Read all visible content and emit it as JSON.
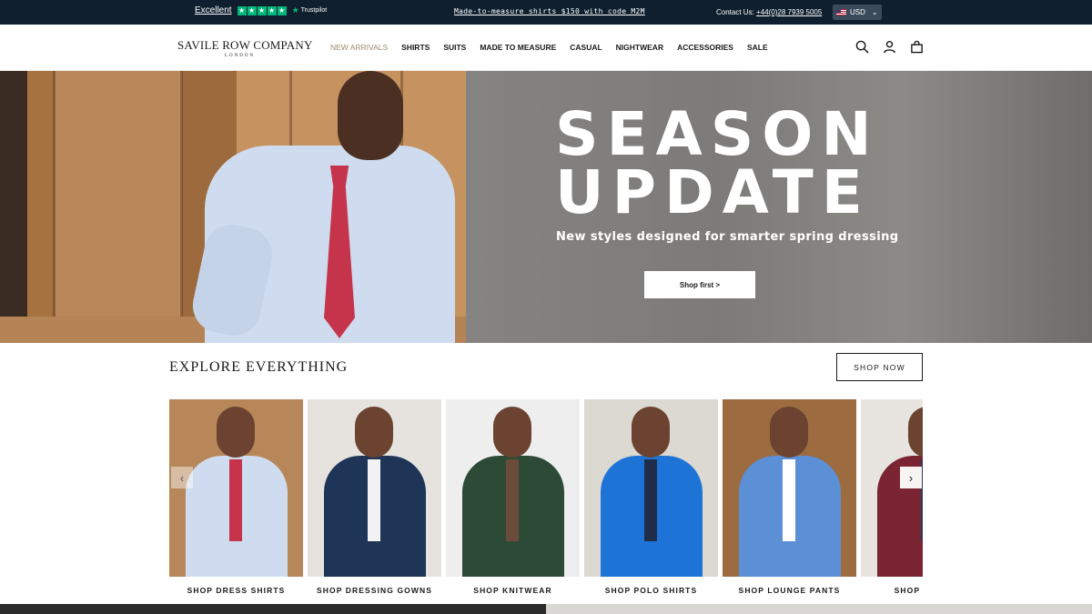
{
  "topbar": {
    "trustpilot_rating": "Excellent",
    "trustpilot_brand": "Trustpilot",
    "stars": [
      "★",
      "★",
      "★",
      "★",
      "★"
    ],
    "promo": "Made-to-measure shirts $150 with code M2M",
    "contact_label": "Contact Us:",
    "contact_phone": "+44(0)28 7939 5005",
    "currency": "USD"
  },
  "header": {
    "logo_main": "SAVILE ROW COMPANY",
    "logo_sub": "LONDON",
    "nav": [
      "NEW ARRIVALS",
      "SHIRTS",
      "SUITS",
      "MADE TO MEASURE",
      "CASUAL",
      "NIGHTWEAR",
      "ACCESSORIES",
      "SALE"
    ],
    "icons": [
      "search-icon",
      "account-icon",
      "bag-icon"
    ]
  },
  "hero": {
    "title_line1": "SEASON",
    "title_line2": "UPDATE",
    "subtitle": "New styles designed for smarter spring dressing",
    "cta": "Shop first >"
  },
  "explore": {
    "title": "EXPLORE EVERYTHING",
    "shop_now": "SHOP NOW",
    "cards": [
      {
        "label": "SHOP DRESS SHIRTS",
        "bg": "#b7875a",
        "fig": "#cfdcef",
        "accent": "#c5344a"
      },
      {
        "label": "SHOP DRESSING GOWNS",
        "bg": "#e6e3df",
        "fig": "#1f3557",
        "accent": "#f2f2f2"
      },
      {
        "label": "SHOP KNITWEAR",
        "bg": "#eeeeee",
        "fig": "#2c4a36",
        "accent": "#6b4b3a"
      },
      {
        "label": "SHOP POLO SHIRTS",
        "bg": "#dcd8d2",
        "fig": "#1e74d6",
        "accent": "#1f2d4a"
      },
      {
        "label": "SHOP LOUNGE PANTS",
        "bg": "#9c6b3f",
        "fig": "#5b8fd6",
        "accent": "#ffffff"
      },
      {
        "label": "SHOP CASUAL",
        "bg": "#e8e5e0",
        "fig": "#7a2531",
        "accent": "#2a3a5a"
      }
    ]
  }
}
